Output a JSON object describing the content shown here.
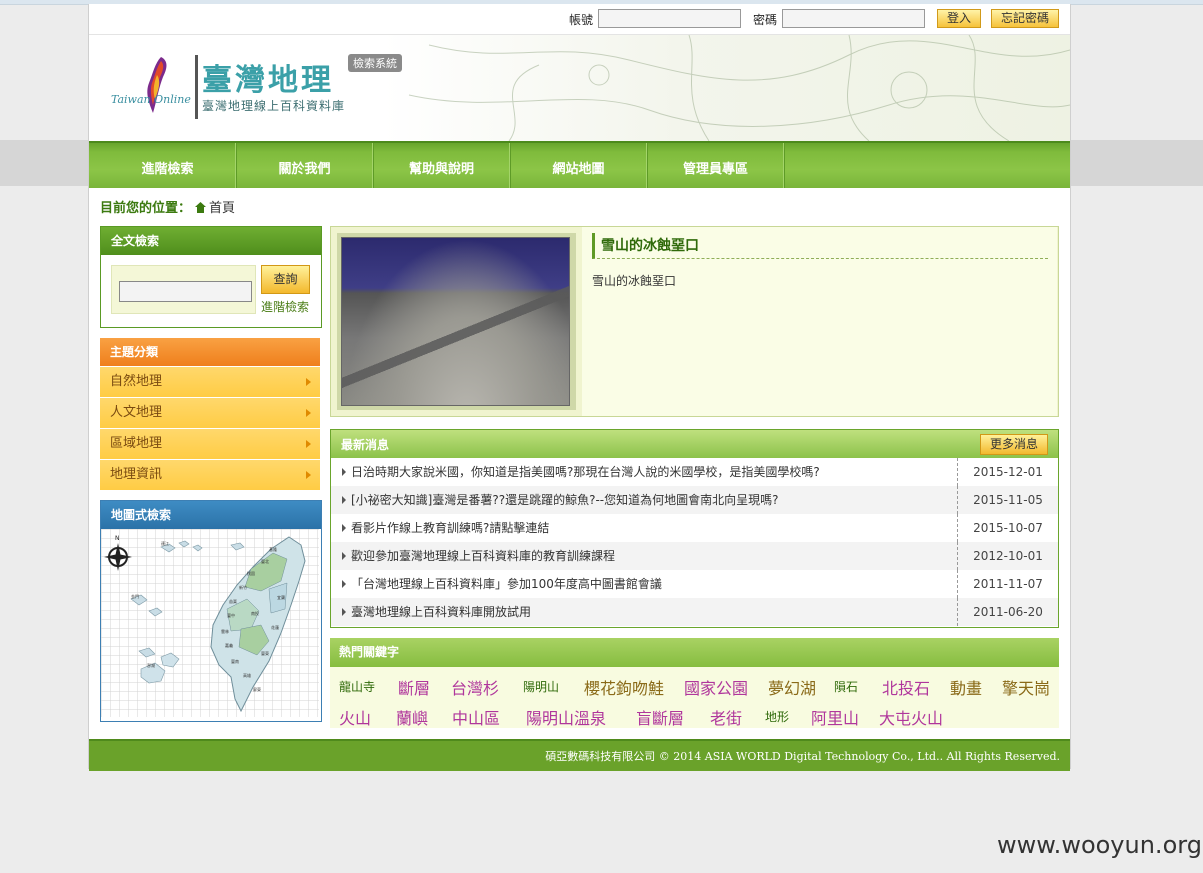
{
  "login": {
    "account_label": "帳號",
    "password_label": "密碼",
    "login_button": "登入",
    "forgot_button": "忘記密碼"
  },
  "header": {
    "logo_title": "臺灣地理",
    "logo_subtitle": "臺灣地理線上百科資料庫",
    "logo_english": "Taiwan Online",
    "system_tag": "檢索系統"
  },
  "nav": [
    "進階檢索",
    "關於我們",
    "幫助與說明",
    "網站地圖",
    "管理員專區"
  ],
  "breadcrumb": {
    "label": "目前您的位置：",
    "current": "首頁"
  },
  "fulltext": {
    "title": "全文檢索",
    "query_button": "查詢",
    "advanced_link": "進階檢索"
  },
  "categories": {
    "title": "主題分類",
    "items": [
      "自然地理",
      "人文地理",
      "區域地理",
      "地理資訊"
    ]
  },
  "map_search": {
    "title": "地圖式檢索"
  },
  "feature": {
    "title": "雪山的冰蝕堊口",
    "description": "雪山的冰蝕堊口"
  },
  "news": {
    "title": "最新消息",
    "more_button": "更多消息",
    "items": [
      {
        "title": "日治時期大家說米國，你知道是指美國嗎?那現在台灣人說的米國學校，是指美國學校嗎?",
        "date": "2015-12-01"
      },
      {
        "title": "[小祕密大知識]臺灣是番薯??還是跳躍的鯨魚?--您知道為何地圖會南北向呈現嗎?",
        "date": "2015-11-05"
      },
      {
        "title": "看影片作線上教育訓練嗎?請點擊連結",
        "date": "2015-10-07"
      },
      {
        "title": "歡迎參加臺灣地理線上百科資料庫的教育訓練課程",
        "date": "2012-10-01"
      },
      {
        "title": "「台灣地理線上百科資料庫」參加100年度高中圖書館會議",
        "date": "2011-11-07"
      },
      {
        "title": "臺灣地理線上百科資料庫開放試用",
        "date": "2011-06-20"
      }
    ]
  },
  "keywords": {
    "title": "熱門關鍵字",
    "row1": [
      "龍山寺",
      "斷層",
      "台灣杉",
      "陽明山",
      "櫻花鉤吻鮭",
      "國家公園",
      "夢幻湖",
      "隕石",
      "北投石",
      "動畫",
      "擎天崗"
    ],
    "row2": [
      "火山",
      "蘭嶼",
      "中山區",
      "陽明山溫泉",
      "盲斷層",
      "老街",
      "地形",
      "阿里山",
      "大屯火山"
    ]
  },
  "footer": {
    "copyright": "碩亞數碼科技有限公司 © 2014 ASIA WORLD Digital Technology Co., Ltd.. All Rights Reserved."
  },
  "watermark": "www.wooyun.org",
  "colors": {
    "nav_green": "#7fbb3c",
    "category_orange": "#ef7f1c",
    "category_yellow": "#ffcc44",
    "map_blue": "#2b72a8",
    "keyword_magenta": "#b0369c",
    "keyword_olive": "#8a6a18",
    "keyword_green": "#2f6a0a"
  }
}
